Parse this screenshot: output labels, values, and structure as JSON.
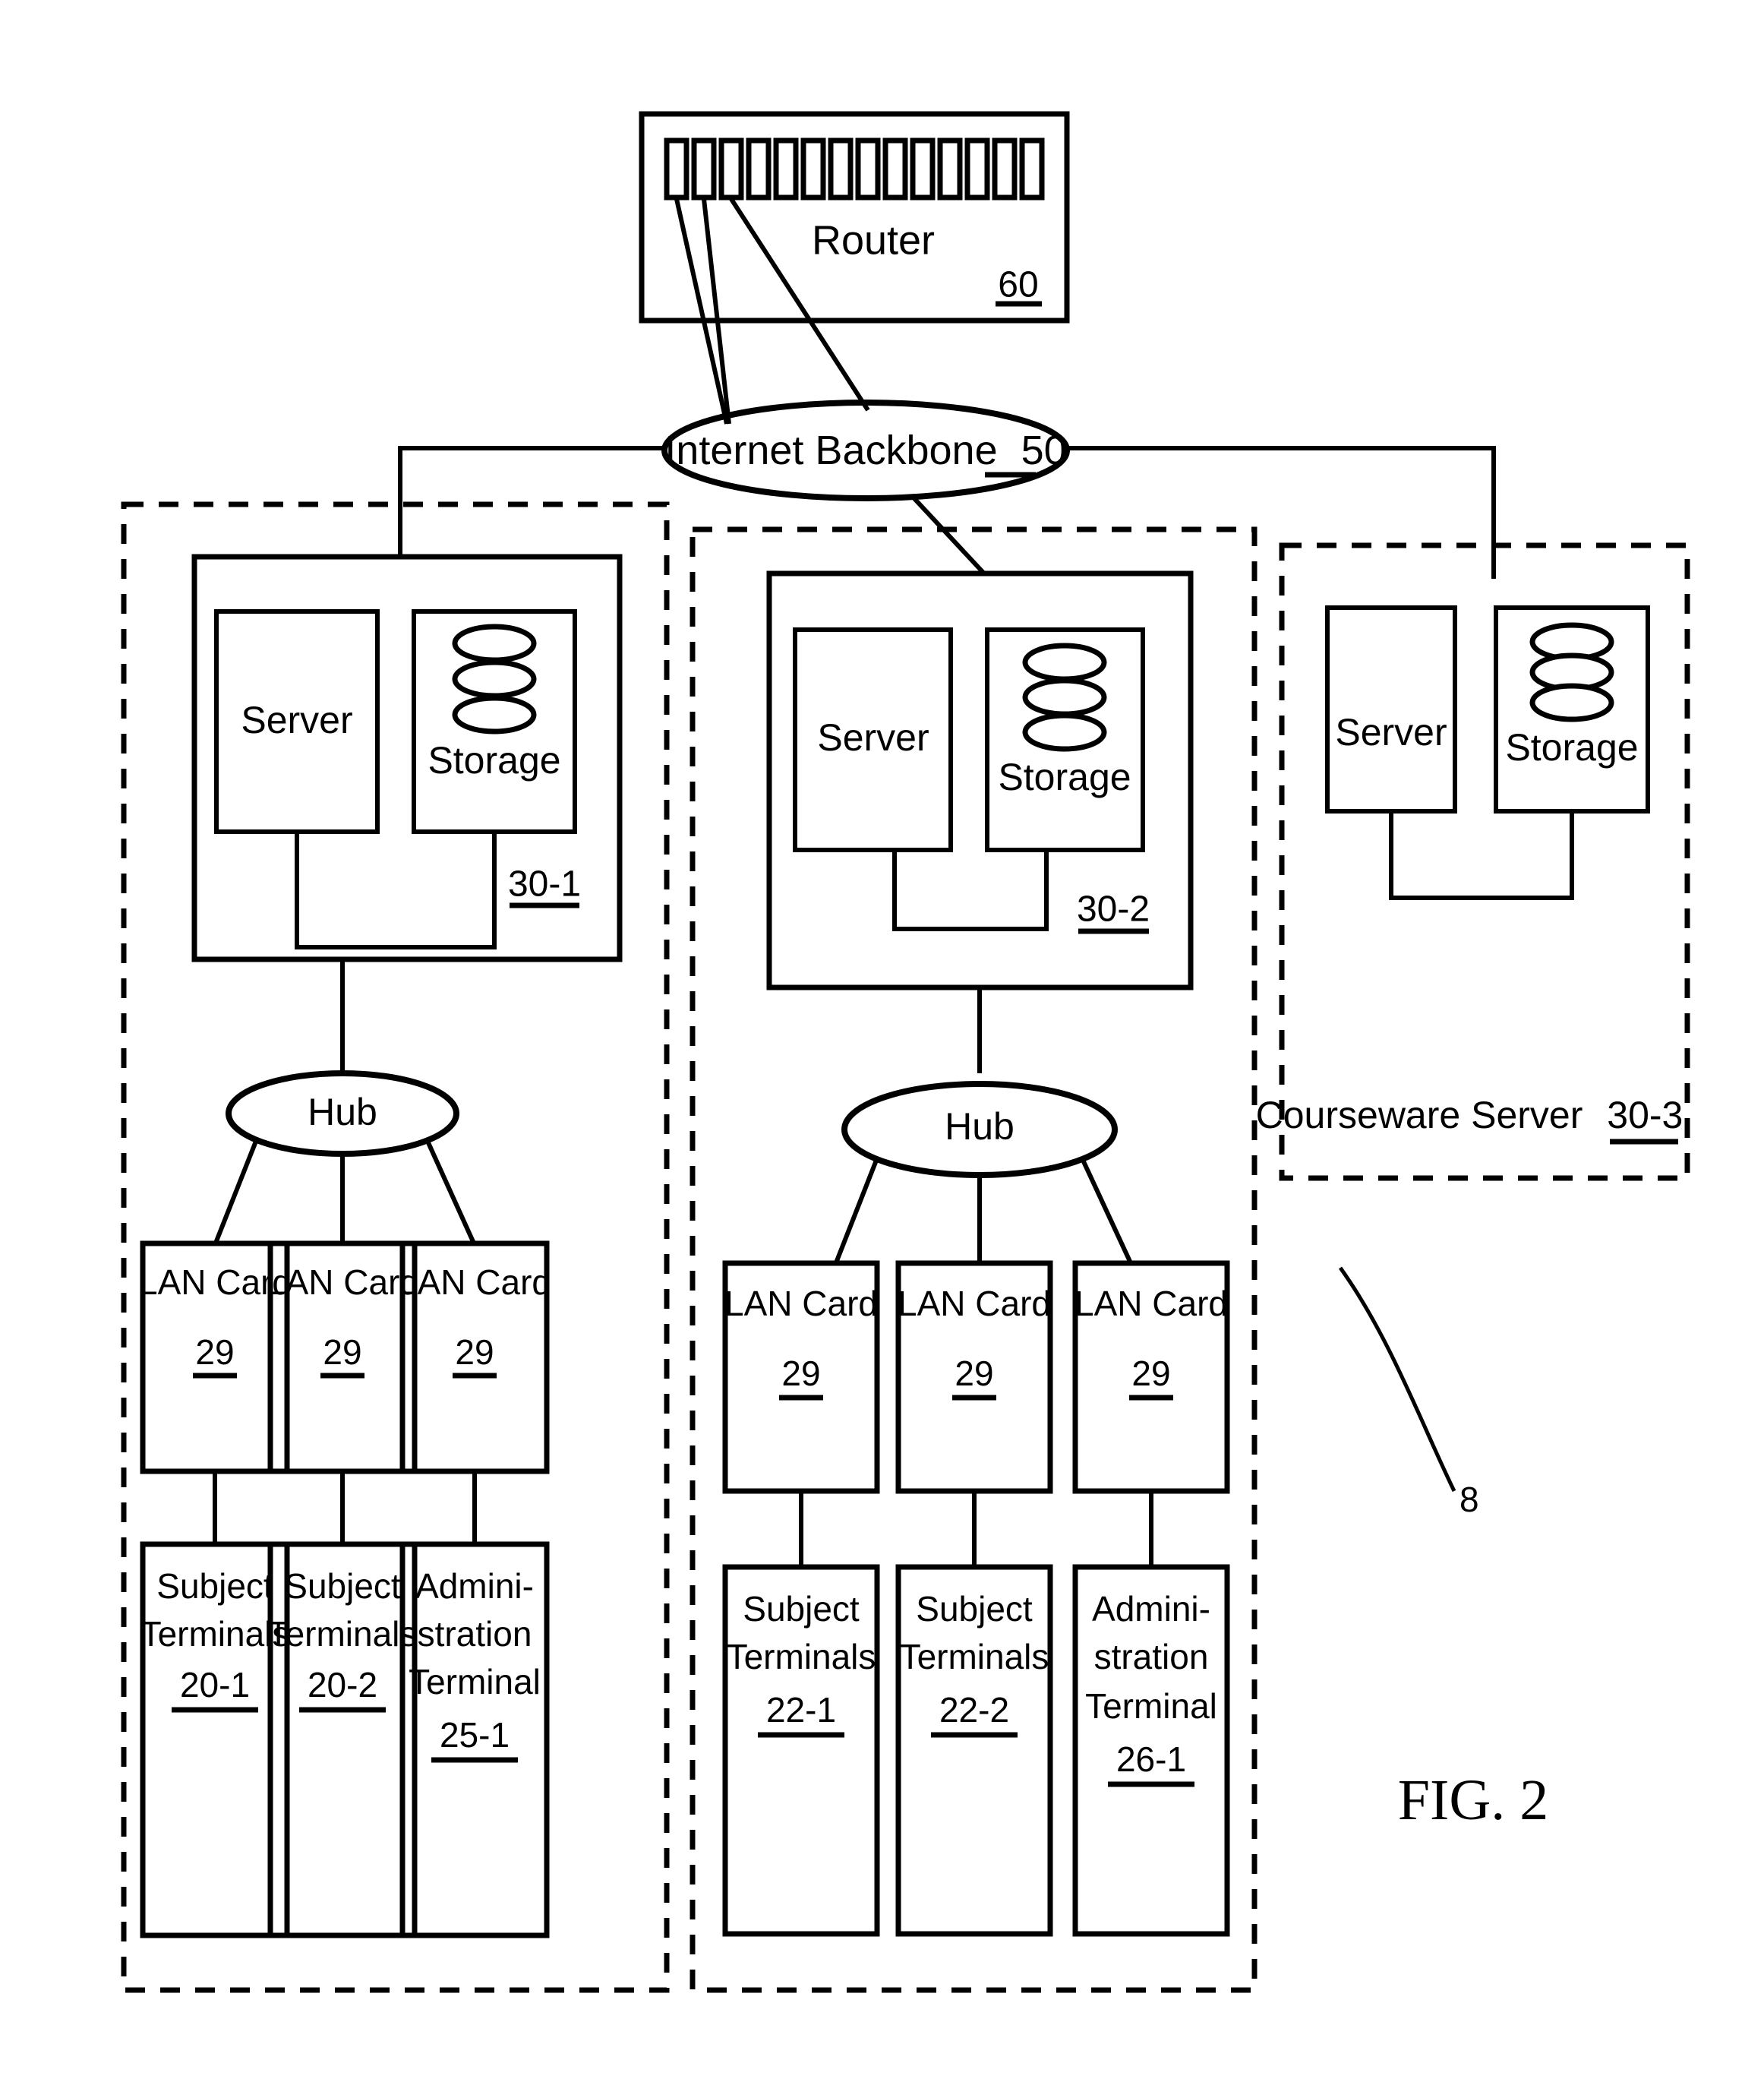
{
  "figure": {
    "label": "FIG. 2",
    "system_ref": "8"
  },
  "router": {
    "label": "Router",
    "ref": "60",
    "port_count": 14
  },
  "backbone": {
    "label": "Internet Backbone",
    "ref": "50"
  },
  "groups": [
    {
      "id": "group-1",
      "server_unit": {
        "ref": "30-1",
        "server_label": "Server",
        "storage_label": "Storage"
      },
      "hub_label": "Hub",
      "lan_cards": [
        {
          "label": "LAN Card",
          "ref": "29"
        },
        {
          "label": "LAN Card",
          "ref": "29"
        },
        {
          "label": "LAN Card",
          "ref": "29"
        }
      ],
      "terminals": [
        {
          "line1": "Subject",
          "line2": "Terminals",
          "line3": "",
          "ref": "20-1"
        },
        {
          "line1": "Subject",
          "line2": "Terminals",
          "line3": "",
          "ref": "20-2"
        },
        {
          "line1": "Admini-",
          "line2": "stration",
          "line3": "Terminal",
          "ref": "25-1"
        }
      ]
    },
    {
      "id": "group-2",
      "server_unit": {
        "ref": "30-2",
        "server_label": "Server",
        "storage_label": "Storage"
      },
      "hub_label": "Hub",
      "lan_cards": [
        {
          "label": "LAN Card",
          "ref": "29"
        },
        {
          "label": "LAN Card",
          "ref": "29"
        },
        {
          "label": "LAN Card",
          "ref": "29"
        }
      ],
      "terminals": [
        {
          "line1": "Subject",
          "line2": "Terminals",
          "line3": "",
          "ref": "22-1"
        },
        {
          "line1": "Subject",
          "line2": "Terminals",
          "line3": "",
          "ref": "22-2"
        },
        {
          "line1": "Admini-",
          "line2": "stration",
          "line3": "Terminal",
          "ref": "26-1"
        }
      ]
    }
  ],
  "courseware": {
    "caption": "Courseware Server",
    "ref": "30-3",
    "server_label": "Server",
    "storage_label": "Storage"
  },
  "colors": {
    "ink": "#000000",
    "paper": "#ffffff"
  }
}
